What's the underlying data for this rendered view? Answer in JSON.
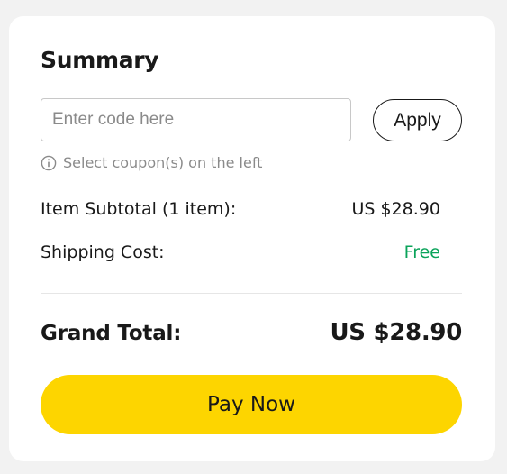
{
  "summary": {
    "title": "Summary",
    "coupon": {
      "placeholder": "Enter code here",
      "value": "",
      "apply_label": "Apply",
      "hint": "Select coupon(s) on the left",
      "hint_icon": "info-icon"
    },
    "subtotal": {
      "label": "Item Subtotal (1 item):",
      "value": "US $28.90"
    },
    "shipping": {
      "label": "Shipping Cost:",
      "value": "Free",
      "value_color": "#0aa35a"
    },
    "grand_total": {
      "label": "Grand Total:",
      "value": "US $28.90"
    },
    "pay_label": "Pay Now",
    "colors": {
      "pay_button": "#fdd500",
      "text": "#191919",
      "muted": "#8a8a8a"
    }
  }
}
